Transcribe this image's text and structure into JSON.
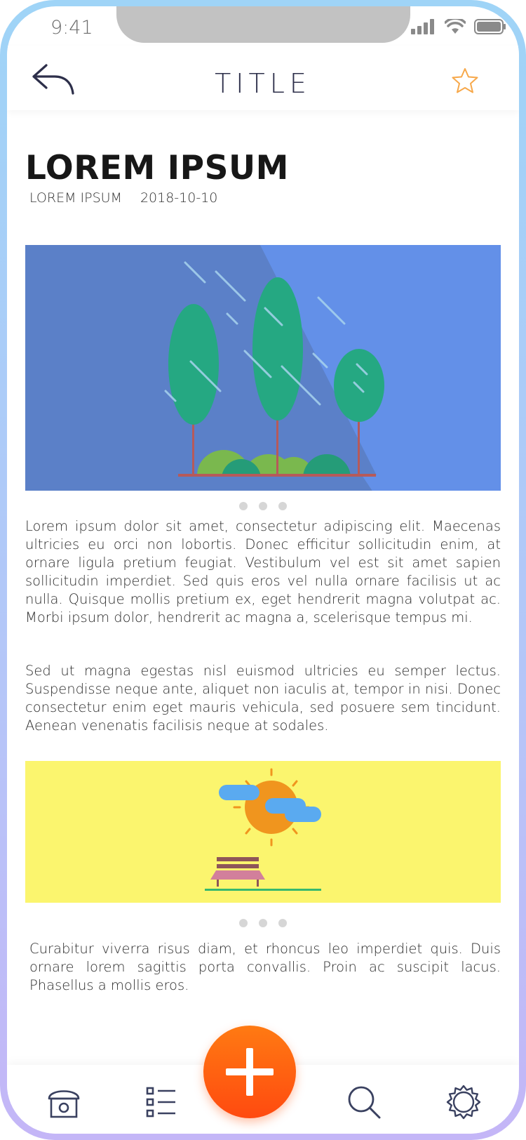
{
  "status_bar": {
    "time": "9:41",
    "icons": [
      "signal-icon",
      "wifi-icon",
      "battery-icon"
    ]
  },
  "header": {
    "title": "TITLE",
    "back_icon": "reply-arrow-icon",
    "favorite_icon": "star-icon"
  },
  "article": {
    "headline": "LOREM IPSUM",
    "author": "LOREM IPSUM",
    "date": "2018-10-10",
    "paragraph_1": "Lorem ipsum dolor sit amet, consectetur adipiscing elit. Maecenas ultricies eu orci non lobortis. Donec efficitur sollicitudin enim, at ornare ligula pretium feugiat. Vestibulum vel est sit amet sapien sollicitudin imperdiet. Sed quis eros vel nulla ornare facilisis ut ac nulla. Quisque mollis pretium ex, eget hendrerit magna volutpat ac. Morbi ipsum dolor, hendrerit ac magna a, scelerisque tempus mi.",
    "paragraph_2": "Sed ut magna egestas nisl euismod ultricies eu semper lectus. Suspendisse neque ante, aliquet non iaculis at, tempor in nisi. Donec consectetur enim eget mauris vehicula, sed posuere sem tincidunt. Aenean venenatis facilisis neque at sodales.",
    "paragraph_3": "Curabitur viverra risus diam, et rhoncus leo imperdiet quis. Duis ornare lorem sagittis porta convallis. Proin ac suscipit lacus. Phasellus a mollis eros."
  },
  "images": [
    {
      "name": "rainy-trees-illustration",
      "colors": {
        "background": "#5b80c8",
        "accent": "#6390e8",
        "trees": "#25a882"
      }
    },
    {
      "name": "sunny-bench-illustration",
      "colors": {
        "background": "#fbf56e",
        "sun": "#f0951e",
        "clouds": "#5aaaf0"
      }
    }
  ],
  "carousel": {
    "dots": 3
  },
  "tab_bar": {
    "items": [
      "home-icon",
      "list-icon",
      "search-icon",
      "settings-icon"
    ],
    "fab_icon": "plus-icon",
    "colors": {
      "fab": "#ff5f12",
      "icons": "#3a4160"
    }
  }
}
